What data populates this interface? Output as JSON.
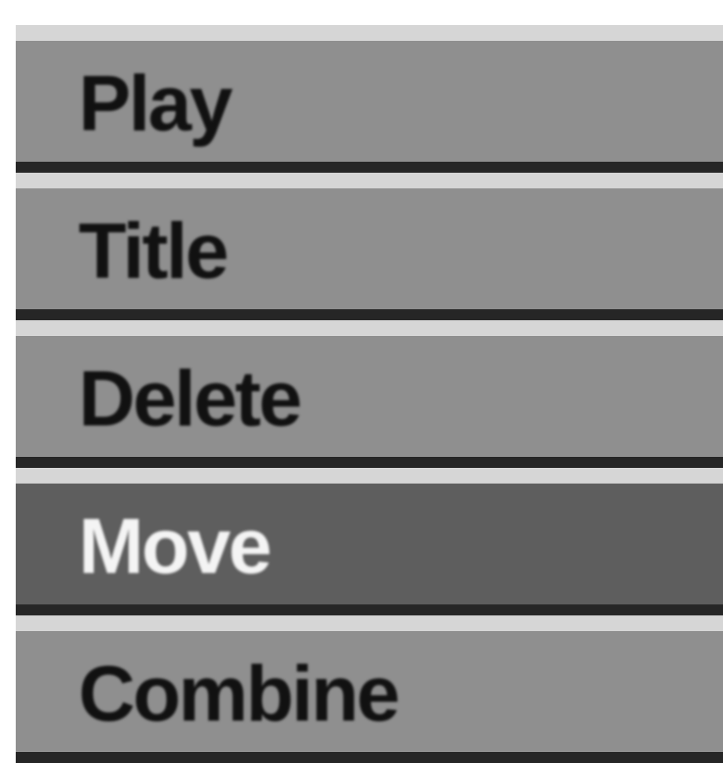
{
  "menu": {
    "items": [
      {
        "label": "Play",
        "selected": false
      },
      {
        "label": "Title",
        "selected": false
      },
      {
        "label": "Delete",
        "selected": false
      },
      {
        "label": "Move",
        "selected": true
      },
      {
        "label": "Combine",
        "selected": false
      }
    ]
  },
  "colors": {
    "item_background": "#8f8f8f",
    "selected_background": "#5e5e5e",
    "item_highlight": "#d6d6d6",
    "item_shadow": "#262626",
    "text": "#111111",
    "selected_text": "#f4f4f4"
  }
}
